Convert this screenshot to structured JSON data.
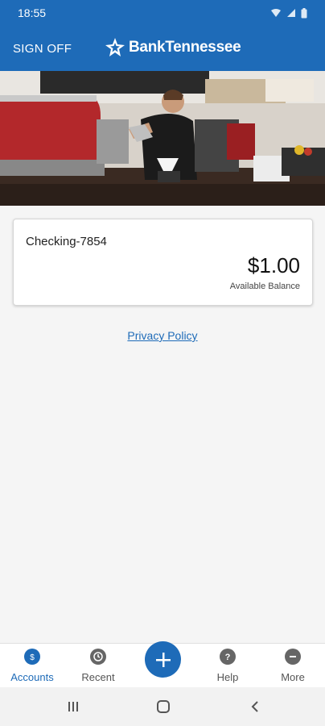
{
  "status_bar": {
    "time": "18:55"
  },
  "header": {
    "sign_off_label": "SIGN OFF",
    "brand": "BankTennessee",
    "brand_color": "#1e6bb8"
  },
  "account": {
    "name": "Checking-7854",
    "balance": "$1.00",
    "balance_label": "Available Balance"
  },
  "privacy_link": "Privacy Policy",
  "bottom_nav": {
    "accounts": "Accounts",
    "recent": "Recent",
    "help": "Help",
    "more": "More"
  }
}
